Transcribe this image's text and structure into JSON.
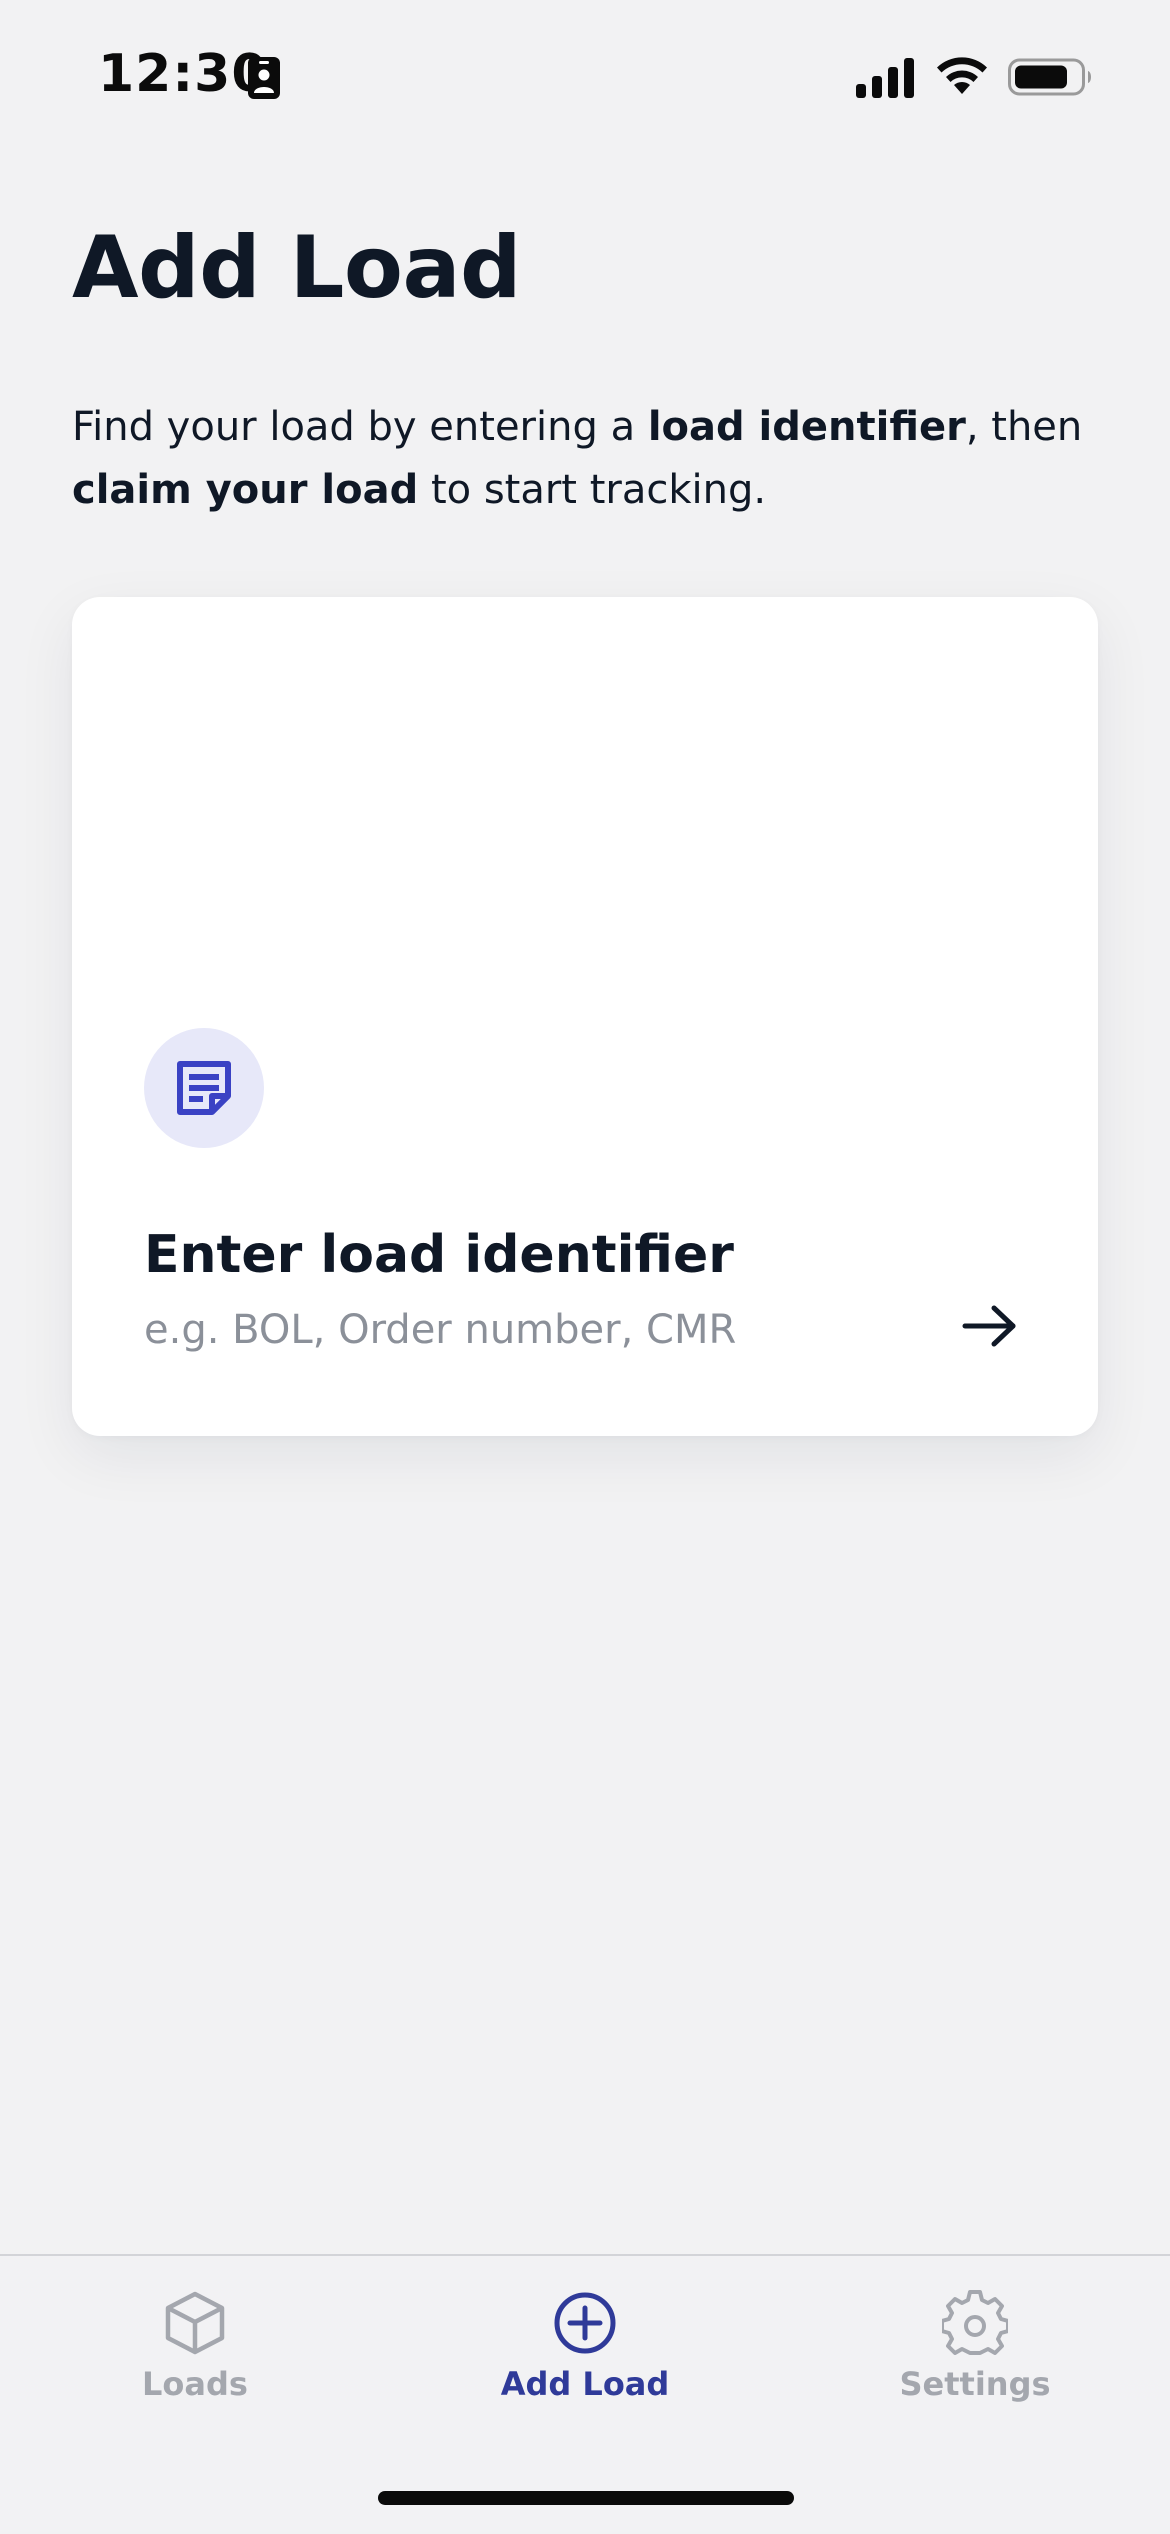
{
  "status_bar": {
    "time": "12:30",
    "icons": [
      "contact-card-icon",
      "cellular-signal-icon",
      "wifi-icon",
      "battery-icon"
    ]
  },
  "page": {
    "title": "Add Load",
    "description": {
      "part1": "Find your load by entering a ",
      "bold1": "load identifier",
      "part2": ", then ",
      "bold2": "claim your load",
      "part3": " to start tracking."
    }
  },
  "card": {
    "icon": "note-document-icon",
    "title": "Enter load identifier",
    "subtitle": "e.g. BOL, Order number, CMR",
    "action_icon": "arrow-right-icon"
  },
  "tab_bar": {
    "items": [
      {
        "label": "Loads",
        "icon": "cube-icon",
        "active": false
      },
      {
        "label": "Add Load",
        "icon": "plus-circle-icon",
        "active": true
      },
      {
        "label": "Settings",
        "icon": "gear-icon",
        "active": false
      }
    ]
  },
  "colors": {
    "background": "#f2f2f3",
    "text_primary": "#0f1826",
    "text_secondary": "#8b9099",
    "accent": "#2f3a99",
    "icon_accent": "#3a42c4",
    "icon_circle_bg": "#e7e8f9",
    "tab_inactive": "#a4a7ae"
  }
}
